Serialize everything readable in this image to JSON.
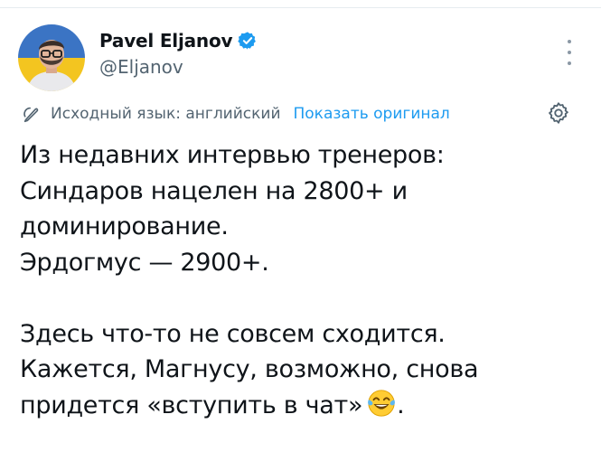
{
  "author": {
    "display_name": "Pavel Eljanov",
    "handle": "@Eljanov",
    "verified": true,
    "avatar_flag_colors": [
      "#3b74c4",
      "#f3c520"
    ]
  },
  "translation": {
    "source_language_text": "Исходный язык: английский",
    "show_original_label": "Показать оригинал"
  },
  "tweet": {
    "lines": [
      "Из недавних интервью тренеров:",
      "Синдаров нацелен на 2800+ и",
      "доминирование.",
      "Эрдогмус — 2900+.",
      "",
      "Здесь что-то не совсем сходится.",
      "Кажется, Магнусу, возможно, снова",
      "придется «вступить в чат»"
    ],
    "trailing_emoji": "face-with-tears-of-joy",
    "trailing_punctuation": "."
  },
  "icons": {
    "verified": "verified-badge-icon",
    "more": "more-options-icon",
    "translate": "translate-icon",
    "settings": "settings-gear-icon"
  },
  "colors": {
    "text": "#0f1419",
    "secondary": "#536471",
    "link": "#1d9bf0",
    "verified": "#1d9bf0"
  }
}
